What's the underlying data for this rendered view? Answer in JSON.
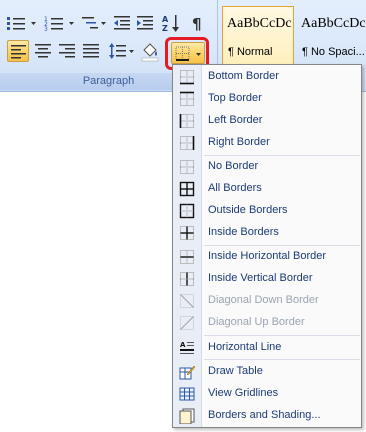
{
  "ribbon": {
    "group_label": "Paragraph",
    "styles": [
      {
        "sample": "AaBbCcDc",
        "name": "¶ Normal",
        "selected": true
      },
      {
        "sample": "AaBbCcDc",
        "name": "¶ No Spaci...",
        "selected": false
      }
    ],
    "icons": [
      "bullets-icon",
      "numbering-icon",
      "multilevel-list-icon",
      "decrease-indent-icon",
      "increase-indent-icon",
      "sort-icon",
      "show-formatting-icon",
      "align-left-icon",
      "center-icon",
      "align-right-icon",
      "justify-icon",
      "line-spacing-icon",
      "shading-icon",
      "borders-icon"
    ]
  },
  "menu": {
    "items": [
      {
        "label": "Bottom Border",
        "icon": "bottom-border-icon",
        "enabled": true
      },
      {
        "label": "Top Border",
        "icon": "top-border-icon",
        "enabled": true
      },
      {
        "label": "Left Border",
        "icon": "left-border-icon",
        "enabled": true
      },
      {
        "label": "Right Border",
        "icon": "right-border-icon",
        "enabled": true
      },
      {
        "label": "No Border",
        "icon": "no-border-icon",
        "enabled": true
      },
      {
        "label": "All Borders",
        "icon": "all-borders-icon",
        "enabled": true
      },
      {
        "label": "Outside Borders",
        "icon": "outside-borders-icon",
        "enabled": true
      },
      {
        "label": "Inside Borders",
        "icon": "inside-borders-icon",
        "enabled": true
      },
      {
        "label": "Inside Horizontal Border",
        "icon": "inside-horizontal-border-icon",
        "enabled": true
      },
      {
        "label": "Inside Vertical Border",
        "icon": "inside-vertical-border-icon",
        "enabled": true
      },
      {
        "label": "Diagonal Down Border",
        "icon": "diagonal-down-border-icon",
        "enabled": false
      },
      {
        "label": "Diagonal Up Border",
        "icon": "diagonal-up-border-icon",
        "enabled": false
      },
      {
        "label": "Horizontal Line",
        "icon": "horizontal-line-icon",
        "enabled": true
      },
      {
        "label": "Draw Table",
        "icon": "draw-table-icon",
        "enabled": true
      },
      {
        "label": "View Gridlines",
        "icon": "view-gridlines-icon",
        "enabled": true
      },
      {
        "label": "Borders and Shading...",
        "icon": "borders-and-shading-icon",
        "enabled": true
      }
    ]
  },
  "colors": {
    "highlight": "#e41b23",
    "menu_text": "#1b3b74",
    "disabled_text": "#9aa4b2",
    "selected_button": "#fcd46a"
  }
}
